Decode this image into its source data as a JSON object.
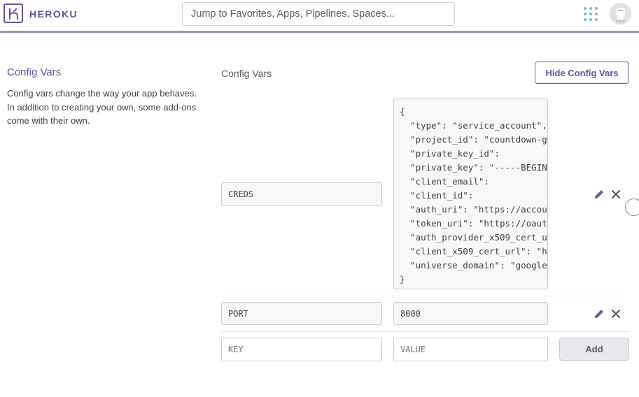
{
  "header": {
    "brand": "HEROKU",
    "search_placeholder": "Jump to Favorites, Apps, Pipelines, Spaces..."
  },
  "section": {
    "title": "Config Vars",
    "description": "Config vars change the way your app behaves. In addition to creating your own, some add-ons come with their own."
  },
  "config": {
    "heading": "Config Vars",
    "hide_button": "Hide Config Vars",
    "vars": [
      {
        "key": "CREDS",
        "value_lines": [
          "{",
          "  \"type\": \"service_account\",",
          "  \"project_id\": \"countdown-g",
          "  \"private_key_id\":",
          "  \"private_key\": \"-----BEGIN",
          "  \"client_email\":",
          "  \"client_id\":",
          "  \"auth_uri\": \"https://accou",
          "  \"token_uri\": \"https://oaut",
          "  \"auth_provider_x509_cert_u",
          "  \"client_x509_cert_url\": \"h",
          "  \"universe_domain\": \"google",
          "}"
        ]
      },
      {
        "key": "PORT",
        "value": "8000"
      }
    ],
    "new_row": {
      "key_placeholder": "KEY",
      "value_placeholder": "VALUE",
      "add_label": "Add"
    }
  },
  "colors": {
    "brand_purple": "#6a4fa4",
    "accent_blue": "#79b8dc"
  }
}
